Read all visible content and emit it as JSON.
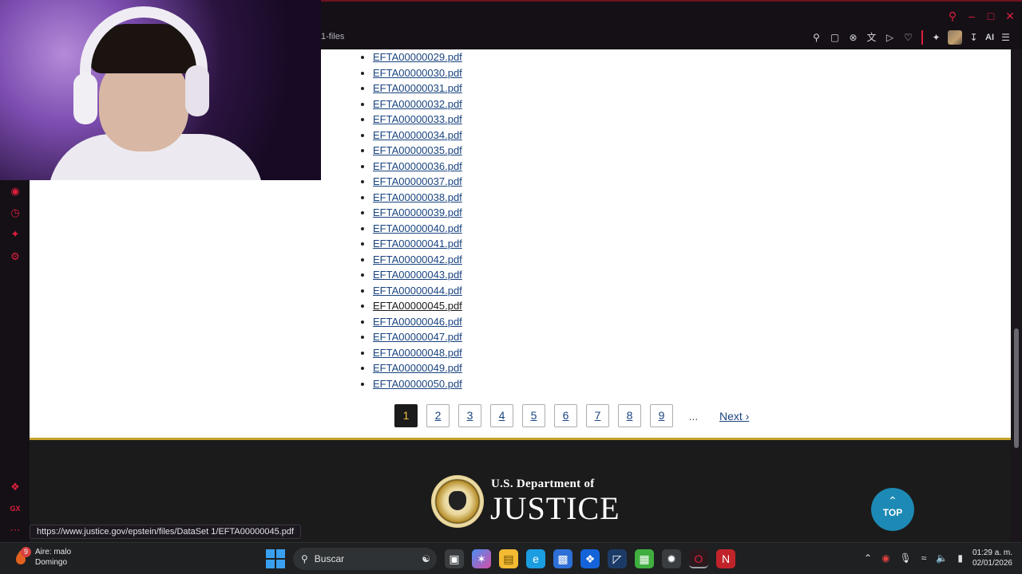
{
  "browser": {
    "tab_text": "1-files",
    "toolbar_ai": "AI",
    "status_url": "https://www.justice.gov/epstein/files/DataSet 1/EFTA00000045.pdf"
  },
  "files": [
    "EFTA00000029.pdf",
    "EFTA00000030.pdf",
    "EFTA00000031.pdf",
    "EFTA00000032.pdf",
    "EFTA00000033.pdf",
    "EFTA00000034.pdf",
    "EFTA00000035.pdf",
    "EFTA00000036.pdf",
    "EFTA00000037.pdf",
    "EFTA00000038.pdf",
    "EFTA00000039.pdf",
    "EFTA00000040.pdf",
    "EFTA00000041.pdf",
    "EFTA00000042.pdf",
    "EFTA00000043.pdf",
    "EFTA00000044.pdf",
    "EFTA00000045.pdf",
    "EFTA00000046.pdf",
    "EFTA00000047.pdf",
    "EFTA00000048.pdf",
    "EFTA00000049.pdf",
    "EFTA00000050.pdf"
  ],
  "pagination": {
    "pages": [
      "1",
      "2",
      "3",
      "4",
      "5",
      "6",
      "7",
      "8",
      "9"
    ],
    "current": "1",
    "ellipsis": "...",
    "next": "Next ›"
  },
  "footer": {
    "dept_line": "U.S. Department of",
    "dept_name": "JUSTICE",
    "top_arrow": "⌃",
    "top_label": "TOP"
  },
  "taskbar": {
    "weather_badge": "9",
    "weather_line1": "Aire: malo",
    "weather_line2": "Domingo",
    "search_label": "Buscar",
    "time": "01:29 a. m.",
    "date": "02/01/2026"
  },
  "colors": {
    "link": "#1a4480",
    "footer_bg": "#1b1b1b",
    "footer_border": "#c5a22d",
    "top_button": "#1d8ab5",
    "browser_accent": "#e01f3d"
  }
}
